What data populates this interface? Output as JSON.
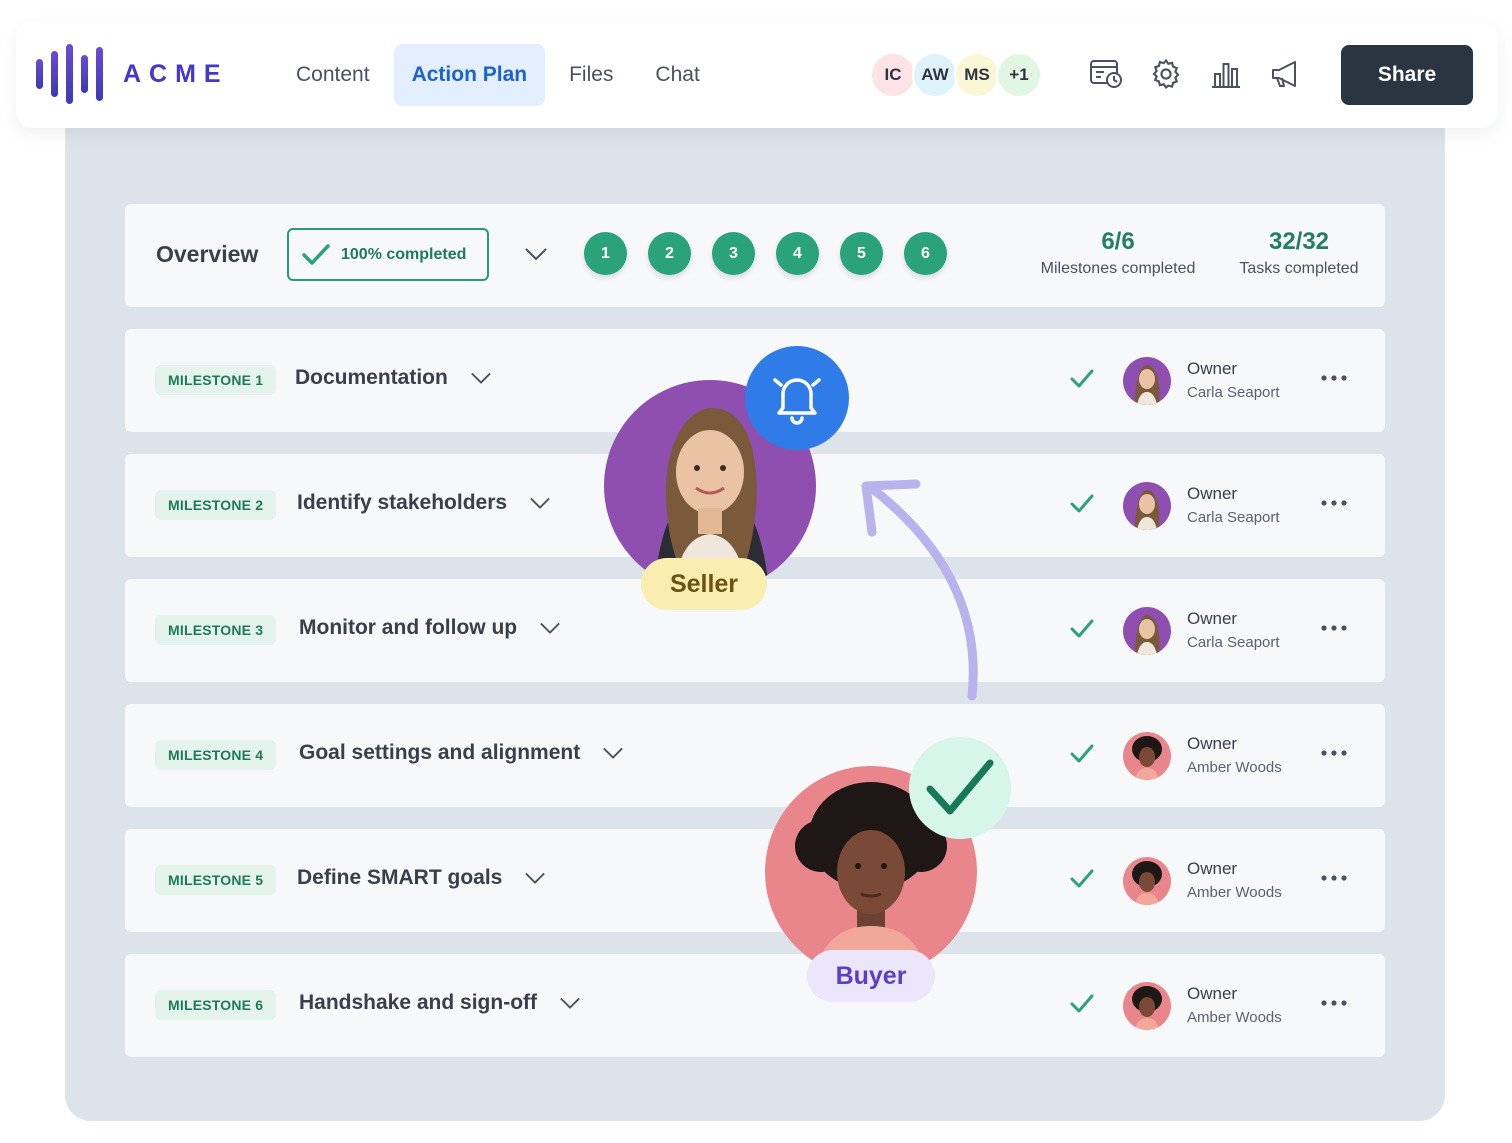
{
  "brand": {
    "name": "ACME",
    "icon": "soundwave-logo-icon",
    "color": "#4338ca"
  },
  "nav": {
    "tabs": [
      {
        "label": "Content",
        "active": false
      },
      {
        "label": "Action Plan",
        "active": true
      },
      {
        "label": "Files",
        "active": false
      },
      {
        "label": "Chat",
        "active": false
      }
    ]
  },
  "collaborators": [
    {
      "initials": "IC",
      "color": "#fde2e6"
    },
    {
      "initials": "AW",
      "color": "#dff3fb"
    },
    {
      "initials": "MS",
      "color": "#fbf6d6"
    },
    {
      "initials": "+1",
      "color": "#e1f7e3"
    }
  ],
  "toolbar": {
    "icons": [
      "calendar-clock-icon",
      "gear-icon",
      "bar-chart-icon",
      "megaphone-icon"
    ],
    "share_label": "Share"
  },
  "overview": {
    "title": "Overview",
    "completion_label": "100% completed",
    "completion_fraction": 1.0,
    "steps": [
      "1",
      "2",
      "3",
      "4",
      "5",
      "6"
    ],
    "milestones_value": "6/6",
    "milestones_label": "Milestones completed",
    "tasks_value": "32/32",
    "tasks_label": "Tasks completed"
  },
  "milestones": [
    {
      "badge": "MILESTONE 1",
      "title": "Documentation",
      "done": true,
      "owner_role": "Owner",
      "owner_name": "Carla Seaport"
    },
    {
      "badge": "MILESTONE 2",
      "title": "Identify stakeholders",
      "done": true,
      "owner_role": "Owner",
      "owner_name": "Carla Seaport"
    },
    {
      "badge": "MILESTONE 3",
      "title": "Monitor and follow up",
      "done": true,
      "owner_role": "Owner",
      "owner_name": "Carla Seaport"
    },
    {
      "badge": "MILESTONE 4",
      "title": "Goal settings and alignment",
      "done": true,
      "owner_role": "Owner",
      "owner_name": "Amber Woods"
    },
    {
      "badge": "MILESTONE 5",
      "title": "Define SMART goals",
      "done": true,
      "owner_role": "Owner",
      "owner_name": "Amber Woods"
    },
    {
      "badge": "MILESTONE 6",
      "title": "Handshake and sign-off",
      "done": true,
      "owner_role": "Owner",
      "owner_name": "Amber Woods"
    }
  ],
  "overlay": {
    "seller_label": "Seller",
    "buyer_label": "Buyer",
    "seller_icon": "bell-icon",
    "buyer_icon": "checkmark-icon",
    "seller_bg": "#8e4fb0",
    "buyer_bg": "#e8868c"
  },
  "colors": {
    "accent_green": "#2aa37a",
    "nav_active": "#1d63c9",
    "share_bg": "#2b3542"
  }
}
